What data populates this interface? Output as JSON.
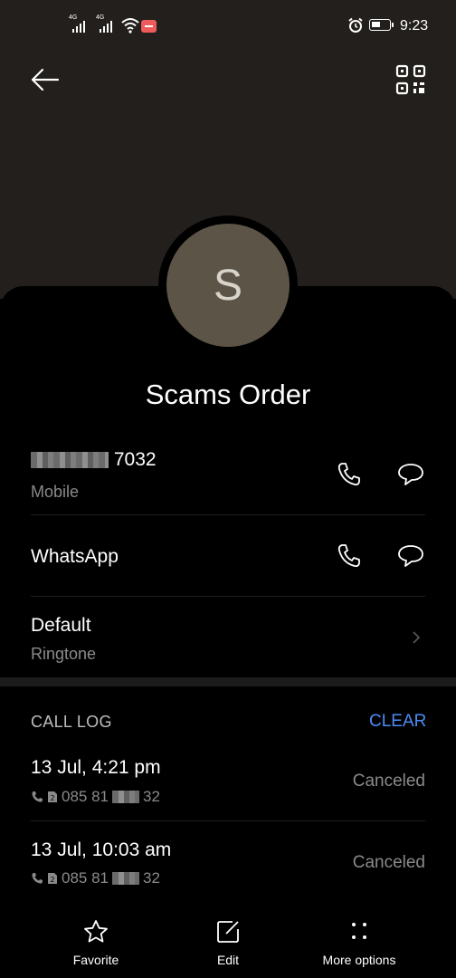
{
  "status_bar": {
    "time": "9:23",
    "network_1": "4G",
    "network_2": "4G"
  },
  "contact": {
    "initial": "S",
    "name": "Scams Order"
  },
  "phone": {
    "number_visible": "7032",
    "type": "Mobile"
  },
  "whatsapp": {
    "label": "WhatsApp"
  },
  "ringtone": {
    "value": "Default",
    "label": "Ringtone"
  },
  "call_log": {
    "title": "CALL LOG",
    "clear_label": "CLEAR",
    "entries": [
      {
        "time": "13 Jul, 4:21 pm",
        "number_start": "085 81",
        "number_end": "32",
        "status": "Canceled"
      },
      {
        "time": "13 Jul, 10:03 am",
        "number_start": "085 81",
        "number_end": "32",
        "status": "Canceled"
      }
    ]
  },
  "bottom_nav": {
    "favorite": "Favorite",
    "edit": "Edit",
    "more": "More options"
  },
  "colors": {
    "header_bg": "#221f1c",
    "avatar_bg": "#5c5446",
    "accent": "#4d8cf5",
    "recording": "#ef5b5b"
  },
  "icons": [
    "back-arrow-icon",
    "qr-code-icon",
    "phone-icon",
    "message-icon",
    "chevron-right-icon",
    "star-icon",
    "edit-icon",
    "more-dots-icon",
    "call-log-icon",
    "sim-icon"
  ]
}
